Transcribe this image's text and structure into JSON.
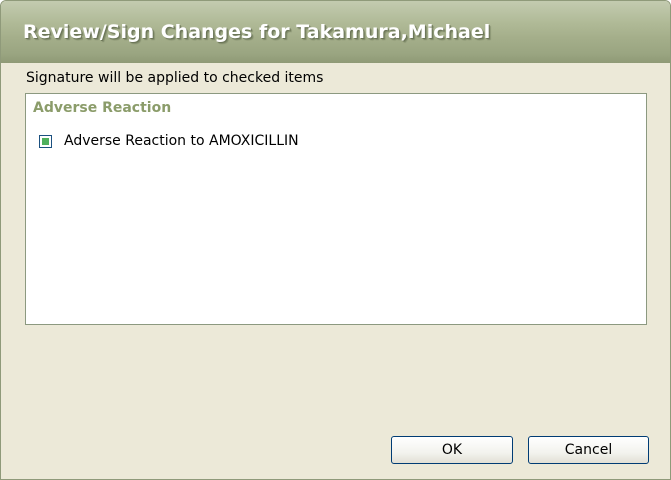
{
  "window": {
    "title": "Review/Sign Changes for Takamura,Michael"
  },
  "caption": "Signature will be applied to checked items",
  "list": {
    "group_header": "Adverse Reaction",
    "items": [
      {
        "label": "Adverse Reaction to AMOXICILLIN",
        "checked": true
      }
    ]
  },
  "buttons": {
    "ok_label": "OK",
    "cancel_label": "Cancel"
  },
  "colors": {
    "titlebar": "#a4ae8a",
    "group_header": "#8b9c6a",
    "window_bg": "#ece9d8",
    "checkbox_fill": "#4fb05d"
  }
}
